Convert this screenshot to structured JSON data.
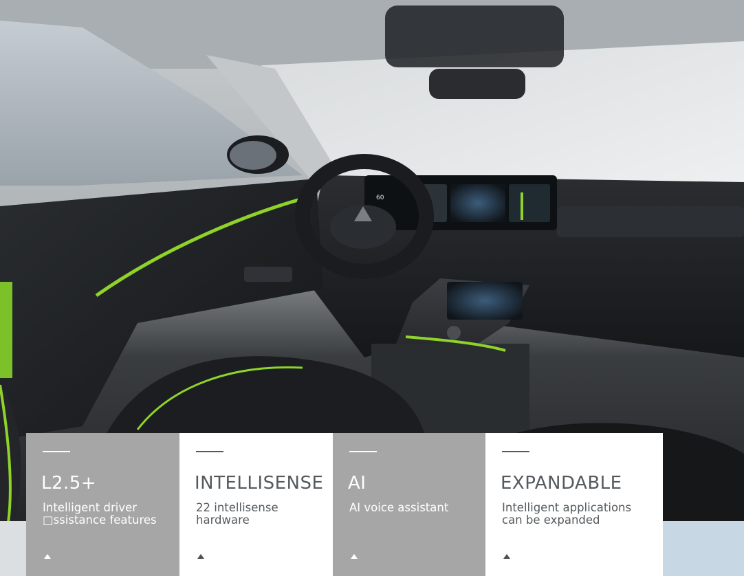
{
  "features": [
    {
      "title": "L2.5+",
      "description": "Intelligent driver\n□ssistance features",
      "theme": "grey"
    },
    {
      "title": "INTELLISENSE",
      "description": "22 intellisense\nhardware",
      "theme": "white"
    },
    {
      "title": "AI",
      "description": "AI voice assistant",
      "theme": "grey"
    },
    {
      "title": "EXPANDABLE",
      "description": "Intelligent applications\ncan be expanded",
      "theme": "white"
    }
  ],
  "cluster_speed": "60",
  "colors": {
    "accent": "#8fd32a",
    "card_grey": "#a6a6a6",
    "card_white": "#ffffff",
    "text_dark": "#555a5e"
  }
}
